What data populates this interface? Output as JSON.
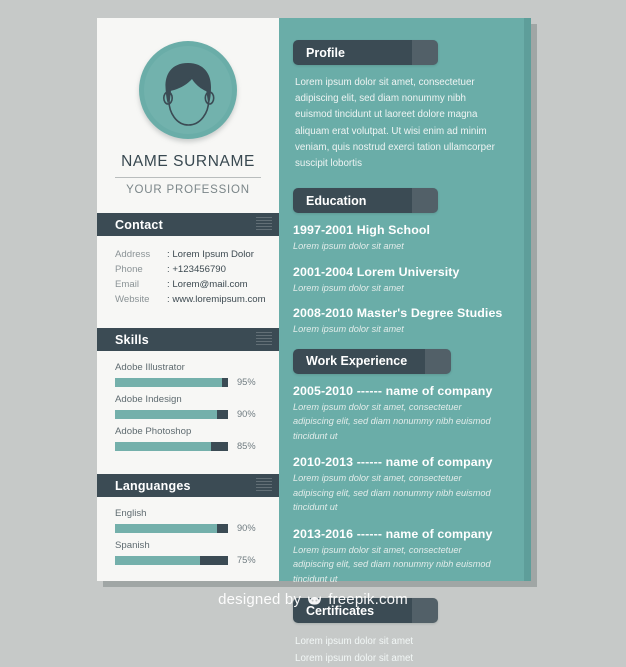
{
  "document": {
    "type": "resume-template",
    "colors": {
      "background": "#c6c9c8",
      "left_panel": "#f7f7f5",
      "right_panel": "#6aada8",
      "right_panel_edge": "#5e9e9a",
      "header_dark": "#3b4b54",
      "accent_teal": "#74b0ab",
      "text_dark": "#3d4a51",
      "text_muted": "#8b9396"
    }
  },
  "left": {
    "avatar": {
      "icon": "user-avatar-icon"
    },
    "name": "NAME SURNAME",
    "profession": "YOUR PROFESSION",
    "contact": {
      "heading": "Contact",
      "rows": [
        {
          "label": "Address",
          "value": ": Lorem Ipsum Dolor"
        },
        {
          "label": "Phone",
          "value": ": +123456790"
        },
        {
          "label": "Email",
          "value": ": Lorem@mail.com"
        },
        {
          "label": "Website",
          "value": ": www.loremipsum.com"
        }
      ]
    },
    "skills": {
      "heading": "Skills",
      "items": [
        {
          "label": "Adobe Illustrator",
          "percent": 95,
          "percent_text": "95%"
        },
        {
          "label": "Adobe Indesign",
          "percent": 90,
          "percent_text": "90%"
        },
        {
          "label": "Adobe Photoshop",
          "percent": 85,
          "percent_text": "85%"
        }
      ]
    },
    "languages": {
      "heading": "Languanges",
      "items": [
        {
          "label": "English",
          "percent": 90,
          "percent_text": "90%"
        },
        {
          "label": "Spanish",
          "percent": 75,
          "percent_text": "75%"
        }
      ]
    }
  },
  "right": {
    "profile": {
      "heading": "Profile",
      "text": "Lorem ipsum dolor sit amet, consectetuer adipiscing elit, sed diam nonummy nibh euismod tincidunt ut laoreet dolore magna aliquam erat volutpat. Ut wisi enim ad minim veniam, quis nostrud exerci tation ullamcorper suscipit lobortis"
    },
    "education": {
      "heading": "Education",
      "items": [
        {
          "title": "1997-2001 High School",
          "subtitle": "Lorem ipsum dolor sit amet"
        },
        {
          "title": "2001-2004 Lorem University",
          "subtitle": "Lorem ipsum dolor sit amet"
        },
        {
          "title": "2008-2010 Master's Degree Studies",
          "subtitle": "Lorem ipsum dolor sit amet"
        }
      ]
    },
    "work": {
      "heading": "Work Experience",
      "items": [
        {
          "title": "2005-2010 ------ name of company",
          "subtitle": "Lorem ipsum dolor sit amet, consectetuer adipiscing elit, sed diam nonummy nibh euismod tincidunt ut"
        },
        {
          "title": "2010-2013 ------ name of company",
          "subtitle": "Lorem ipsum dolor sit amet, consectetuer adipiscing elit, sed diam nonummy nibh euismod tincidunt ut"
        },
        {
          "title": "2013-2016 ------ name of company",
          "subtitle": "Lorem ipsum dolor sit amet, consectetuer adipiscing elit, sed diam nonummy nibh euismod tincidunt ut"
        }
      ]
    },
    "certificates": {
      "heading": "Certificates",
      "lines": [
        "Lorem ipsum dolor sit amet",
        "Lorem ipsum dolor sit amet"
      ]
    }
  },
  "footer": {
    "prefix": "designed by",
    "brand": "freepik.com",
    "icon": "freepik-crown-icon"
  }
}
